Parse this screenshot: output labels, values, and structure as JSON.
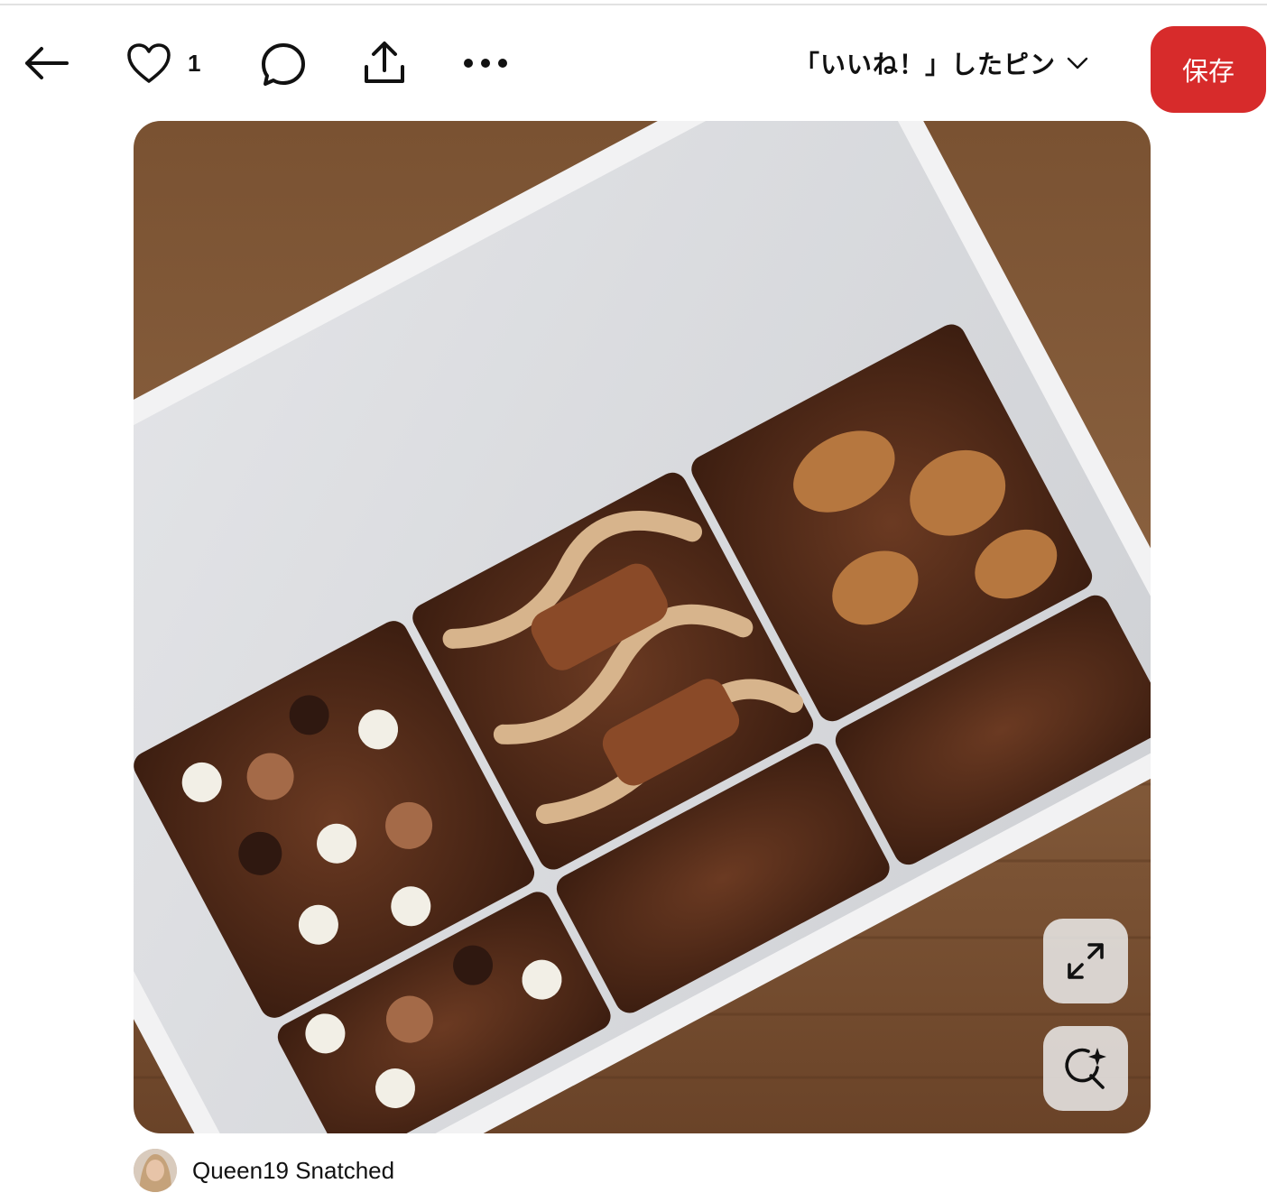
{
  "toolbar": {
    "like_count": "1",
    "board_label": "「いいね！」したピン",
    "save_label": "保存"
  },
  "pin": {
    "image_description_icon": "photo",
    "expand_icon": "expand-icon",
    "lens_icon": "visual-search-icon"
  },
  "author": {
    "name": "Queen19 Snatched"
  },
  "colors": {
    "save_button": "#d72b2b",
    "text": "#111111"
  }
}
